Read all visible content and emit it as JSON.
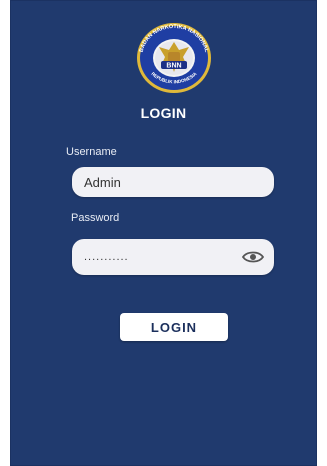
{
  "logo": {
    "top_text": "BADAN NARKOTIKA NASIONAL",
    "center_text": "BNN",
    "bottom_text": "REPUBLIK INDONESIA",
    "icon": "bnn-emblem-icon"
  },
  "title": "LOGIN",
  "form": {
    "username_label": "Username",
    "username_value": "Admin",
    "password_label": "Password",
    "password_value": "...........",
    "toggle_icon": "eye-icon"
  },
  "login_button_label": "LOGIN",
  "colors": {
    "background": "#203a6e",
    "field": "#f1f1f5",
    "button_text": "#1b2f5c",
    "emblem_gold": "#e0b93a",
    "emblem_blue": "#1f3ea3"
  }
}
